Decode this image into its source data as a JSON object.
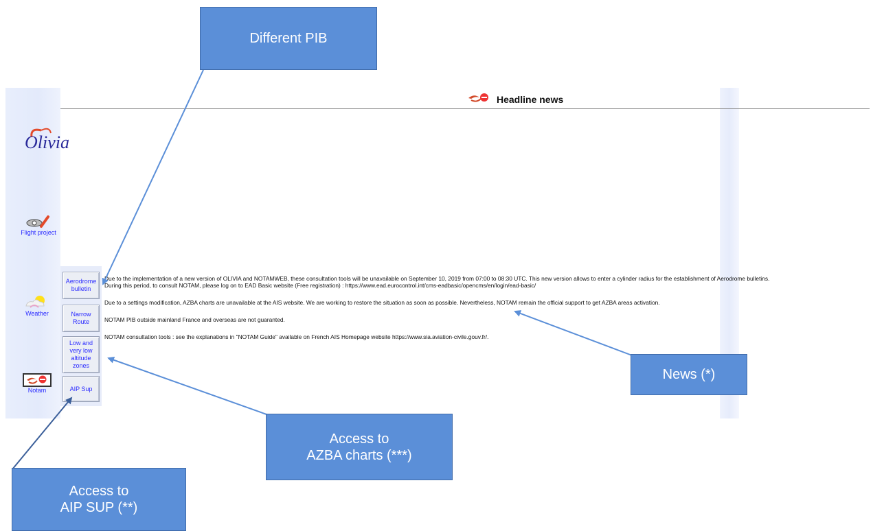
{
  "header": {
    "title": "Headline news"
  },
  "sidebar": {
    "logo_text": "Olivia",
    "items": [
      {
        "label": "Flight project"
      },
      {
        "label": "Weather"
      },
      {
        "label": "Notam"
      }
    ]
  },
  "submenu": {
    "buttons": [
      {
        "label": "Aerodrome bulletin"
      },
      {
        "label": "Narrow Route"
      },
      {
        "label": "Low and very low altitude zones"
      },
      {
        "label": "AIP Sup"
      }
    ]
  },
  "news": [
    "Due to the implementation of a new version of OLIVIA and NOTAMWEB, these consultation tools will be unavailable on September 10, 2019 from 07:00 to 08:30 UTC. This new version allows to enter a cylinder radius for the establishment of Aerodrome bulletins.",
    "During this period, to consult NOTAM, please log on to EAD Basic website (Free registration) : https://www.ead.eurocontrol.int/cms-eadbasic/opencms/en/login/ead-basic/",
    "Due to a settings modification, AZBA charts are unavailable at the AIS website. We are working to restore the situation as soon as possible. Nevertheless, NOTAM remain the official support to get AZBA areas activation.",
    "NOTAM PIB outside mainland France and overseas are not guaranted.",
    "NOTAM consultation tools : see the explanations in \"NOTAM Guide\" available on French AIS Homepage website https://www.sia.aviation-civile.gouv.fr/."
  ],
  "callouts": {
    "pib": "Different PIB",
    "news": "News (*)",
    "azba_line1": "Access to",
    "azba_line2": "AZBA charts (***)",
    "aip_line1": "Access to",
    "aip_line2": "AIP SUP (**)"
  },
  "colors": {
    "callout_fill": "#5b8fd8",
    "arrow": "#5b8fd8",
    "link_text": "#2a2aff"
  }
}
